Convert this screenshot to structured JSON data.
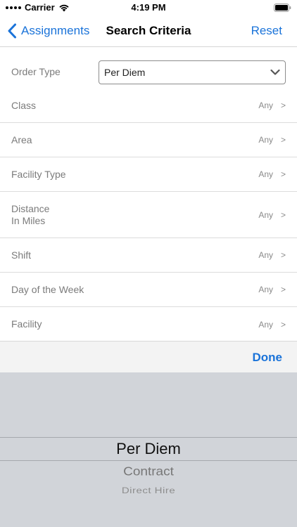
{
  "status_bar": {
    "carrier": "Carrier",
    "time": "4:19 PM",
    "icons": [
      "signal-dots-icon",
      "wifi-icon",
      "battery-icon"
    ]
  },
  "nav": {
    "back_label": "Assignments",
    "title": "Search Criteria",
    "reset_label": "Reset",
    "accent_color": "#1a73d9"
  },
  "order_type": {
    "label": "Order Type",
    "selected": "Per Diem"
  },
  "criteria": [
    {
      "label": "Class",
      "value": "Any",
      "chevron": ">"
    },
    {
      "label": "Area",
      "value": "Any",
      "chevron": ">"
    },
    {
      "label": "Facility Type",
      "value": "Any",
      "chevron": ">"
    },
    {
      "label": "Distance\nIn Miles",
      "value": "Any",
      "chevron": ">"
    },
    {
      "label": "Shift",
      "value": "Any",
      "chevron": ">"
    },
    {
      "label": "Day of the Week",
      "value": "Any",
      "chevron": ">"
    },
    {
      "label": "Facility",
      "value": "Any",
      "chevron": ">"
    }
  ],
  "picker": {
    "done_label": "Done",
    "options": [
      "Per Diem",
      "Contract",
      "Direct Hire"
    ],
    "selected": "Per Diem"
  }
}
